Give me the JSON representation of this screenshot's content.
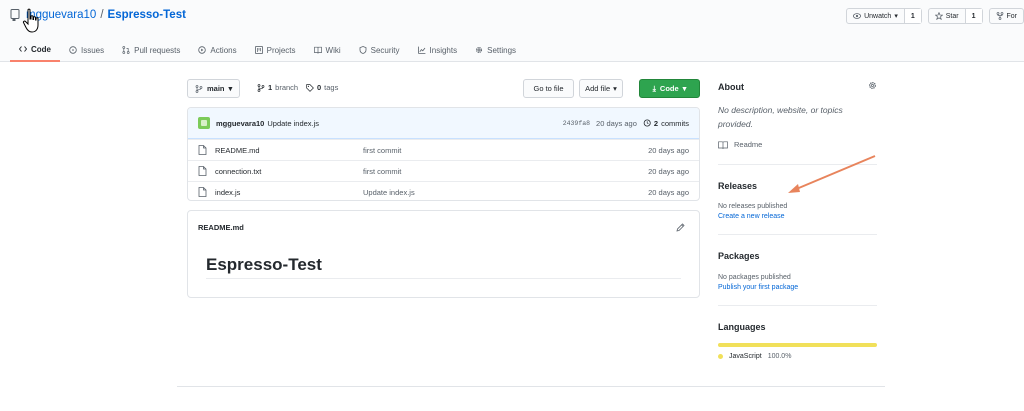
{
  "repo": {
    "owner": "mgguevara10",
    "separator": "/",
    "name": "Espresso-Test"
  },
  "header_actions": {
    "watch_label": "Unwatch",
    "watch_count": "1",
    "star_label": "Star",
    "star_count": "1",
    "fork_label": "For"
  },
  "tabs": [
    {
      "label": "Code",
      "icon": "code-icon",
      "active": true
    },
    {
      "label": "Issues",
      "icon": "issue-icon"
    },
    {
      "label": "Pull requests",
      "icon": "pull-request-icon"
    },
    {
      "label": "Actions",
      "icon": "play-icon"
    },
    {
      "label": "Projects",
      "icon": "project-icon"
    },
    {
      "label": "Wiki",
      "icon": "book-icon"
    },
    {
      "label": "Security",
      "icon": "shield-icon"
    },
    {
      "label": "Insights",
      "icon": "graph-icon"
    },
    {
      "label": "Settings",
      "icon": "gear-icon"
    }
  ],
  "file_nav": {
    "branch": "main",
    "branch_count": "1",
    "branch_word": "branch",
    "tag_count": "0",
    "tag_word": "tags",
    "go_to_file": "Go to file",
    "add_file": "Add file",
    "code": "Code"
  },
  "latest_commit": {
    "author": "mgguevara10",
    "message": "Update index.js",
    "sha": "2439fa8",
    "age": "20 days ago",
    "commit_count": "2",
    "commit_word": "commits"
  },
  "files": [
    {
      "name": "README.md",
      "message": "first commit",
      "age": "20 days ago"
    },
    {
      "name": "connection.txt",
      "message": "first commit",
      "age": "20 days ago"
    },
    {
      "name": "index.js",
      "message": "Update index.js",
      "age": "20 days ago"
    }
  ],
  "readme": {
    "filename": "README.md",
    "heading": "Espresso-Test"
  },
  "sidebar": {
    "about_title": "About",
    "about_desc": "No description, website, or topics provided.",
    "readme_link": "Readme",
    "releases_title": "Releases",
    "releases_text": "No releases published",
    "releases_link": "Create a new release",
    "packages_title": "Packages",
    "packages_text": "No packages published",
    "packages_link": "Publish your first package",
    "languages_title": "Languages",
    "language_name": "JavaScript",
    "language_pct": "100.0%"
  },
  "colors": {
    "link": "#0366d6",
    "primary_button": "#2ea44f",
    "active_tab_underline": "#f9826c",
    "javascript": "#f1e05a",
    "annotation_arrow": "#e8845c"
  }
}
